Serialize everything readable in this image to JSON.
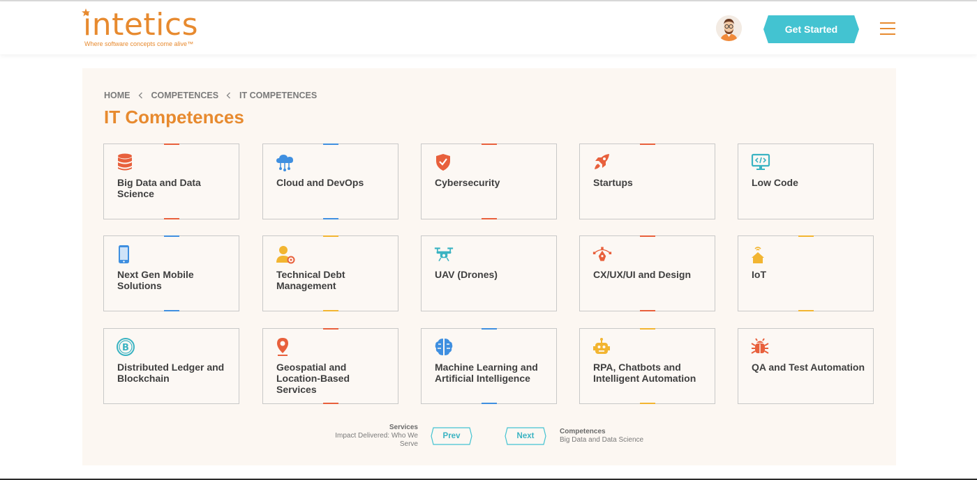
{
  "header": {
    "logo_text": "intetics",
    "logo_tagline": "Where software concepts come alive™",
    "cta_label": "Get Started",
    "accent_color": "#e78a2f",
    "cta_color": "#43c3d1"
  },
  "breadcrumb": [
    "HOME",
    "COMPETENCES",
    "IT COMPETENCES"
  ],
  "page_title": "IT Competences",
  "cards": [
    {
      "label": "Big Data and Data Science",
      "icon": "database-icon",
      "color": "#e8603c"
    },
    {
      "label": "Cloud and DevOps",
      "icon": "cloud-network-icon",
      "color": "#3f8fe0"
    },
    {
      "label": "Cybersecurity",
      "icon": "shield-check-icon",
      "color": "#e8603c"
    },
    {
      "label": "Startups",
      "icon": "rocket-icon",
      "color": "#e8603c"
    },
    {
      "label": "Low Code",
      "icon": "monitor-code-icon",
      "color": "#3ab3c2"
    },
    {
      "label": "Next Gen Mobile Solutions",
      "icon": "mobile-phone-icon",
      "color": "#3f8fe0"
    },
    {
      "label": "Technical Debt Management",
      "icon": "user-gear-icon",
      "color": "#f2b531"
    },
    {
      "label": "UAV (Drones)",
      "icon": "drone-icon",
      "color": "#3ab3c2"
    },
    {
      "label": "CX/UX/UI and Design",
      "icon": "pen-tool-icon",
      "color": "#e8603c"
    },
    {
      "label": "IoT",
      "icon": "smart-home-icon",
      "color": "#f2b531"
    },
    {
      "label": "Distributed Ledger and Blockchain",
      "icon": "bitcoin-icon",
      "color": "#3ab3c2"
    },
    {
      "label": "Geospatial and Location-Based Services",
      "icon": "map-pin-icon",
      "color": "#e8603c"
    },
    {
      "label": "Machine Learning and Artificial Intelligence",
      "icon": "brain-icon",
      "color": "#3f8fe0"
    },
    {
      "label": "RPA, Chatbots and Intelligent Automation",
      "icon": "robot-icon",
      "color": "#f2b531"
    },
    {
      "label": "QA and Test Automation",
      "icon": "bug-icon",
      "color": "#e8603c"
    }
  ],
  "pager": {
    "prev_title": "Services",
    "prev_subtitle": "Impact Delivered: Who We Serve",
    "prev_label": "Prev",
    "next_label": "Next",
    "next_title": "Competences",
    "next_subtitle": "Big Data and Data Science"
  }
}
